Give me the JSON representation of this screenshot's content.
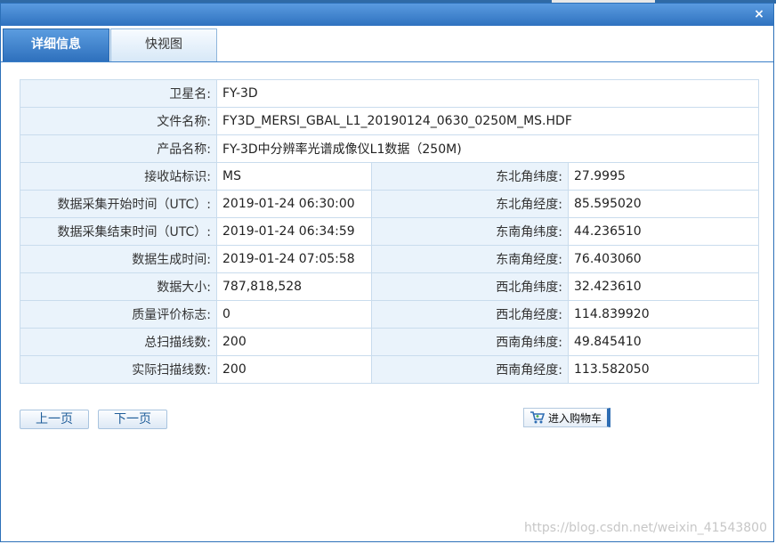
{
  "dialog": {
    "close_label": "×"
  },
  "tabs": [
    {
      "label": "详细信息",
      "active": true
    },
    {
      "label": "快视图",
      "active": false
    }
  ],
  "info": {
    "full_rows": [
      {
        "label": "卫星名:",
        "value": "FY-3D"
      },
      {
        "label": "文件名称:",
        "value": "FY3D_MERSI_GBAL_L1_20190124_0630_0250M_MS.HDF"
      },
      {
        "label": "产品名称:",
        "value": "FY-3D中分辨率光谱成像仪L1数据（250M)"
      }
    ],
    "pair_rows": [
      {
        "l1": "接收站标识:",
        "v1": "MS",
        "l2": "东北角纬度:",
        "v2": "27.9995"
      },
      {
        "l1": "数据采集开始时间（UTC）:",
        "v1": "2019-01-24 06:30:00",
        "l2": "东北角经度:",
        "v2": "85.595020"
      },
      {
        "l1": "数据采集结束时间（UTC）:",
        "v1": "2019-01-24 06:34:59",
        "l2": "东南角纬度:",
        "v2": "44.236510"
      },
      {
        "l1": "数据生成时间:",
        "v1": "2019-01-24 07:05:58",
        "l2": "东南角经度:",
        "v2": "76.403060"
      },
      {
        "l1": "数据大小:",
        "v1": "787,818,528",
        "l2": "西北角纬度:",
        "v2": "32.423610"
      },
      {
        "l1": "质量评价标志:",
        "v1": "0",
        "l2": "西北角经度:",
        "v2": "114.839920"
      },
      {
        "l1": "总扫描线数:",
        "v1": "200",
        "l2": "西南角纬度:",
        "v2": "49.845410"
      },
      {
        "l1": "实际扫描线数:",
        "v1": "200",
        "l2": "西南角经度:",
        "v2": "113.582050"
      }
    ]
  },
  "buttons": {
    "prev": "上一页",
    "next": "下一页",
    "cart": "进入购物车"
  },
  "watermark": "https://blog.csdn.net/weixin_41543800",
  "colors": {
    "title_bar": "#2f72bf",
    "label_cell_bg": "#eaf3fb",
    "border": "#c9dced",
    "button_text": "#1f5d99"
  }
}
